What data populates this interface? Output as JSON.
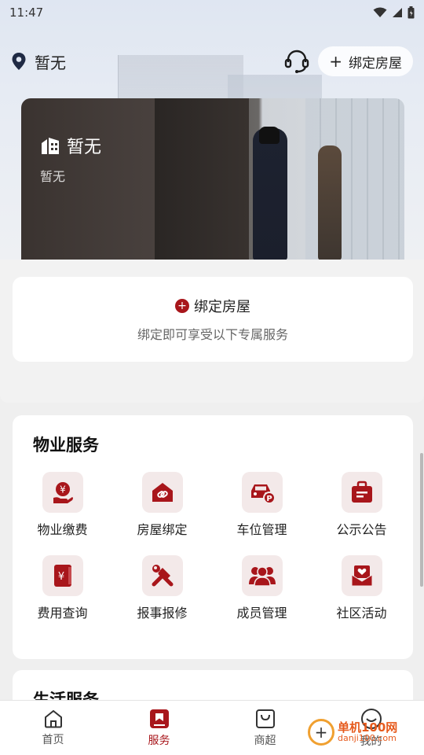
{
  "status_bar": {
    "time": "11:47"
  },
  "header": {
    "location": "暂无",
    "bind_button": "绑定房屋"
  },
  "house_card": {
    "title": "暂无",
    "subtitle": "暂无"
  },
  "bind_prompt": {
    "title": "绑定房屋",
    "subtitle": "绑定即可享受以下专属服务"
  },
  "property_services": {
    "title": "物业服务",
    "items": [
      {
        "label": "物业缴费",
        "icon": "yen-hand-icon"
      },
      {
        "label": "房屋绑定",
        "icon": "house-link-icon"
      },
      {
        "label": "车位管理",
        "icon": "car-parking-icon"
      },
      {
        "label": "公示公告",
        "icon": "notice-bag-icon"
      },
      {
        "label": "费用查询",
        "icon": "yen-book-icon"
      },
      {
        "label": "报事报修",
        "icon": "tools-icon"
      },
      {
        "label": "成员管理",
        "icon": "members-icon"
      },
      {
        "label": "社区活动",
        "icon": "heart-mail-icon"
      }
    ]
  },
  "life_services": {
    "title": "生活服务"
  },
  "bottom_nav": {
    "items": [
      {
        "label": "首页",
        "icon": "home-icon"
      },
      {
        "label": "服务",
        "icon": "bookmark-icon"
      },
      {
        "label": "商超",
        "icon": "shopping-bag-icon"
      },
      {
        "label": "我的",
        "icon": "smile-icon"
      }
    ],
    "active_index": 1
  },
  "watermark": {
    "brand": "单机100网",
    "url": "danji100.com"
  },
  "colors": {
    "accent": "#a8161b",
    "icon_bg": "#f3e9e9"
  }
}
